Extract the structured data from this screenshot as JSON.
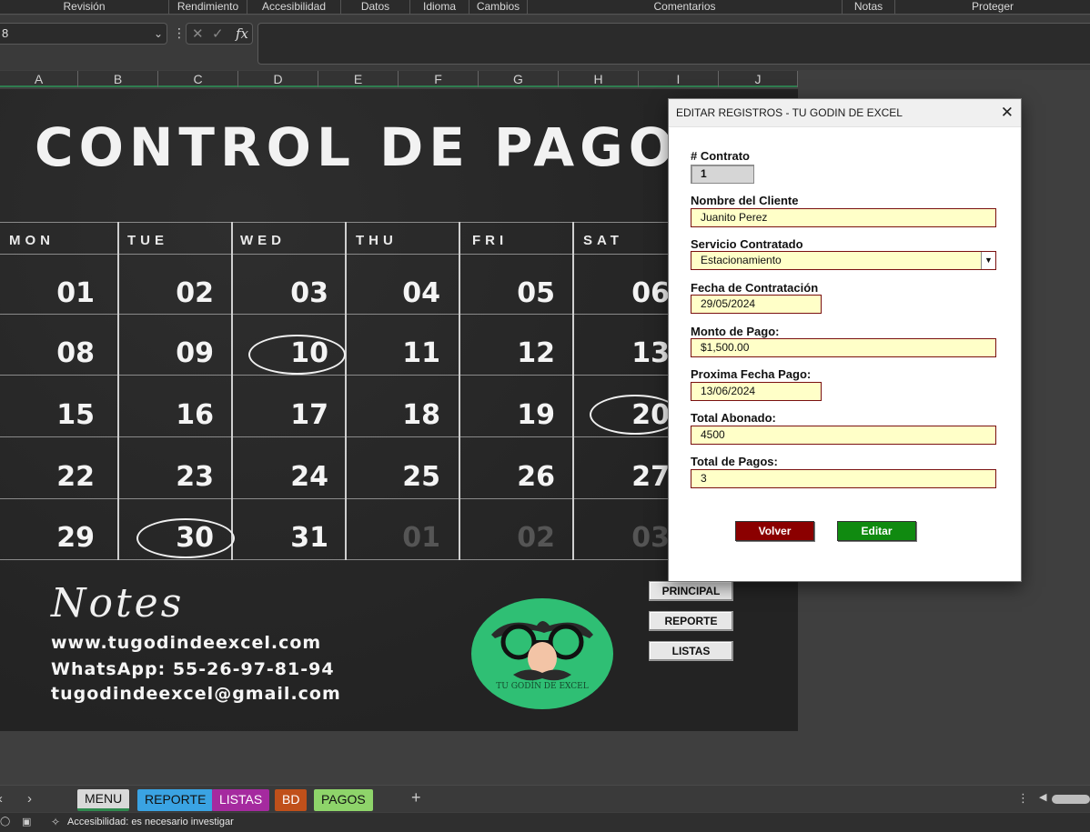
{
  "ribbon": {
    "groups": [
      "Revisión",
      "Rendimiento",
      "Accesibilidad",
      "Datos",
      "Idioma",
      "Cambios",
      "Comentarios",
      "Notas",
      "Proteger"
    ]
  },
  "formula_bar": {
    "name_box": "8",
    "fx": "fx",
    "value": ""
  },
  "columns": [
    "A",
    "B",
    "C",
    "D",
    "E",
    "F",
    "G",
    "H",
    "I",
    "J"
  ],
  "sheet": {
    "title": "CONTROL DE PAGO",
    "days": [
      "MON",
      "TUE",
      "WED",
      "THU",
      "FRI",
      "SAT"
    ],
    "weeks": [
      [
        "01",
        "02",
        "03",
        "04",
        "05",
        "06"
      ],
      [
        "08",
        "09",
        "10",
        "11",
        "12",
        "13"
      ],
      [
        "15",
        "16",
        "17",
        "18",
        "19",
        "20"
      ],
      [
        "22",
        "23",
        "24",
        "25",
        "26",
        "27"
      ],
      [
        "29",
        "30",
        "31",
        "01",
        "02",
        "03"
      ]
    ],
    "notes_heading": "Notes",
    "website": "www.tugodindeexcel.com",
    "whatsapp": "WhatsApp: 55-26-97-81-94",
    "email": "tugodindeexcel@gmail.com",
    "logo_text": "TU GODÍN DE EXCEL",
    "buttons": {
      "principal": "PRINCIPAL",
      "reporte": "REPORTE",
      "listas": "LISTAS"
    }
  },
  "dialog": {
    "title": "EDITAR REGISTROS - TU GODIN DE EXCEL",
    "fields": {
      "contrato_label": "# Contrato",
      "contrato_value": "1",
      "cliente_label": "Nombre del Cliente",
      "cliente_value": "Juanito Perez",
      "servicio_label": "Servicio Contratado",
      "servicio_value": "Estacionamiento",
      "fecha_label": "Fecha de Contratación",
      "fecha_value": "29/05/2024",
      "monto_label": "Monto de Pago:",
      "monto_value": "$1,500.00",
      "proxima_label": "Proxima Fecha Pago:",
      "proxima_value": "13/06/2024",
      "abonado_label": "Total Abonado:",
      "abonado_value": "4500",
      "pagos_label": "Total de Pagos:",
      "pagos_value": "3"
    },
    "buttons": {
      "volver": "Volver",
      "editar": "Editar"
    },
    "colors": {
      "volver": "#8b0000",
      "editar": "#108a10",
      "field_bg": "#ffffc8"
    }
  },
  "sheet_tabs": [
    {
      "label": "MENU",
      "color": "#d9d9d9",
      "active": true
    },
    {
      "label": "REPORTE",
      "color": "#3aa3e3"
    },
    {
      "label": "LISTAS",
      "color": "#a52a9f"
    },
    {
      "label": "BD",
      "color": "#c0501a"
    },
    {
      "label": "PAGOS",
      "color": "#8ed46a"
    }
  ],
  "status": {
    "accessibility": "Accesibilidad: es necesario investigar"
  }
}
